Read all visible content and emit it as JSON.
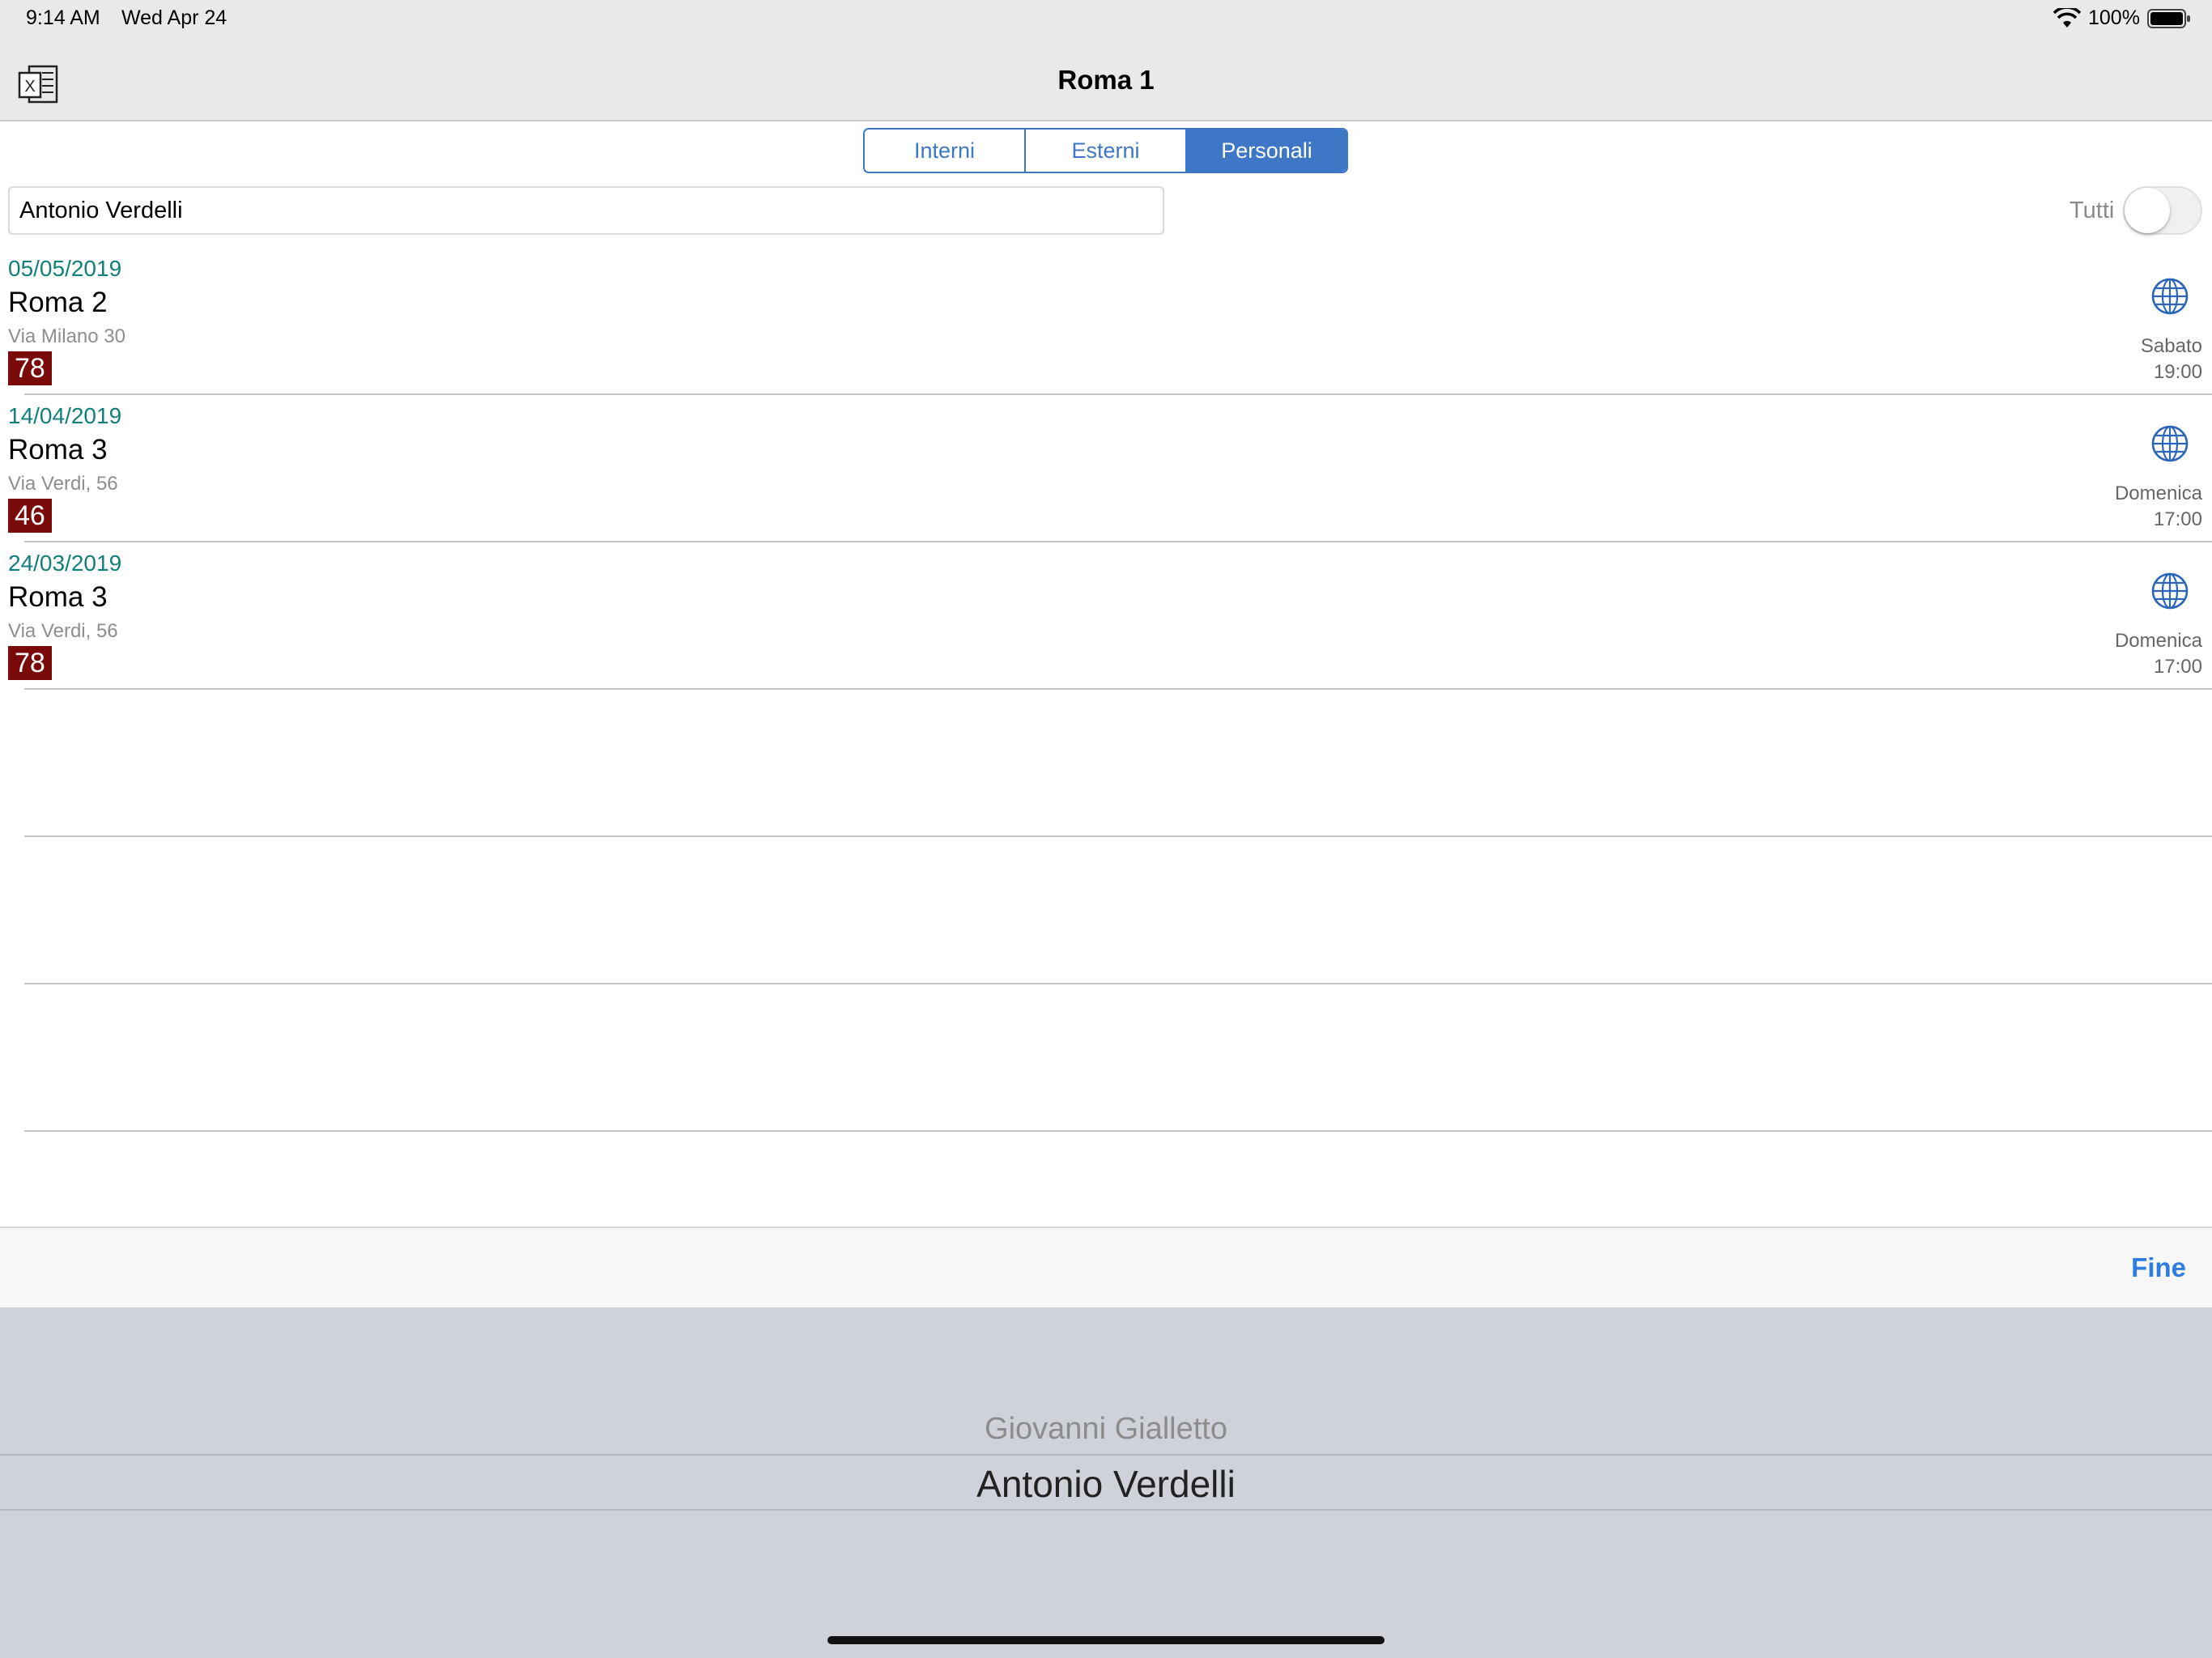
{
  "status_bar": {
    "time": "9:14 AM",
    "date": "Wed Apr 24",
    "battery_percent": "100%",
    "icons": [
      "wifi-icon",
      "battery-icon"
    ]
  },
  "nav": {
    "title": "Roma 1",
    "excel_icon": "excel-export-icon"
  },
  "segments": [
    {
      "label": "Interni",
      "selected": false
    },
    {
      "label": "Esterni",
      "selected": false
    },
    {
      "label": "Personali",
      "selected": true
    }
  ],
  "filter": {
    "value": "Antonio Verdelli",
    "toggle_label": "Tutti",
    "toggle_on": false
  },
  "rows": [
    {
      "date": "05/05/2019",
      "title": "Roma 2",
      "address": "Via Milano 30",
      "score": "78",
      "day": "Sabato",
      "time": "19:00"
    },
    {
      "date": "14/04/2019",
      "title": "Roma 3",
      "address": "Via Verdi, 56",
      "score": "46",
      "day": "Domenica",
      "time": "17:00"
    },
    {
      "date": "24/03/2019",
      "title": "Roma 3",
      "address": "Via Verdi, 56",
      "score": "78",
      "day": "Domenica",
      "time": "17:00"
    }
  ],
  "toolbar": {
    "done_label": "Fine"
  },
  "picker": {
    "options": [
      "Giovanni Gialletto",
      "Antonio Verdelli"
    ],
    "selected_index": 1
  },
  "colors": {
    "accent": "#3d77c5",
    "date_teal": "#127f7a",
    "badge": "#7a0a0a",
    "done_blue": "#2f7de1"
  }
}
